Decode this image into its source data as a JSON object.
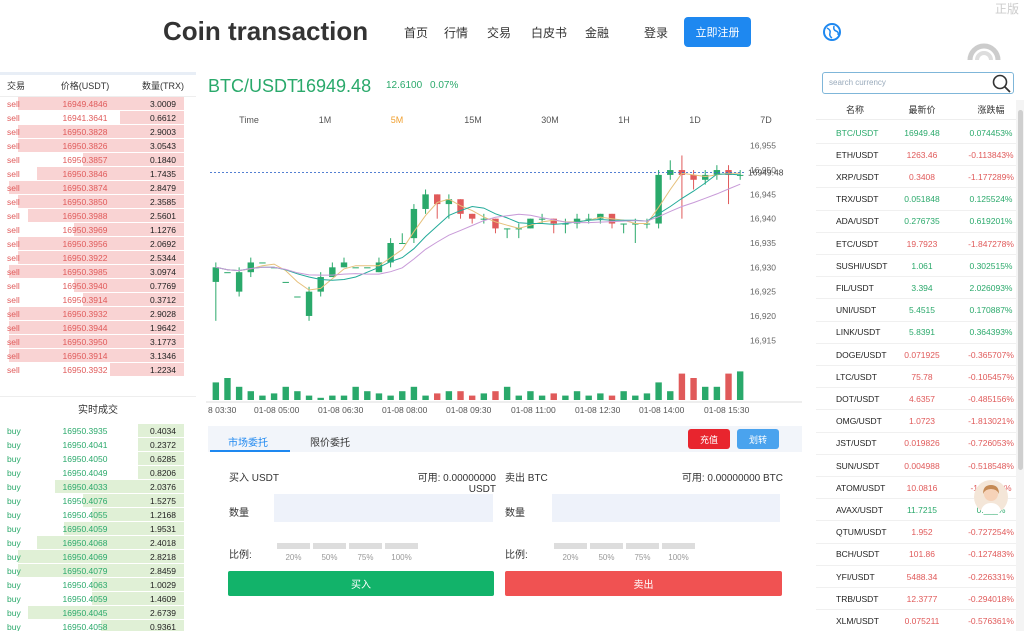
{
  "header": {
    "title": "Coin transaction",
    "nav": [
      "首页",
      "行情",
      "交易",
      "白皮书",
      "金融"
    ],
    "login": "登录",
    "register": "立即注册",
    "watermark": "正版"
  },
  "orderbook": {
    "headers": [
      "交易",
      "价格(USDT)",
      "数量(TRX)"
    ],
    "sells": [
      {
        "side": "sell",
        "price": "16949.4846",
        "qty": "3.0009",
        "depth": 0.9
      },
      {
        "side": "sell",
        "price": "16941.3641",
        "qty": "0.6612",
        "depth": 0.35
      },
      {
        "side": "sell",
        "price": "16950.3828",
        "qty": "2.9003",
        "depth": 0.9
      },
      {
        "side": "sell",
        "price": "16950.3826",
        "qty": "3.0543",
        "depth": 0.9
      },
      {
        "side": "sell",
        "price": "16950.3857",
        "qty": "0.1840",
        "depth": 0.55
      },
      {
        "side": "sell",
        "price": "16950.3846",
        "qty": "1.7435",
        "depth": 0.8
      },
      {
        "side": "sell",
        "price": "16950.3874",
        "qty": "2.8479",
        "depth": 0.95
      },
      {
        "side": "sell",
        "price": "16950.3850",
        "qty": "2.3585",
        "depth": 0.9
      },
      {
        "side": "sell",
        "price": "16950.3988",
        "qty": "2.5601",
        "depth": 0.85
      },
      {
        "side": "sell",
        "price": "16950.3969",
        "qty": "1.1276",
        "depth": 0.6
      },
      {
        "side": "sell",
        "price": "16950.3956",
        "qty": "2.0692",
        "depth": 0.9
      },
      {
        "side": "sell",
        "price": "16950.3922",
        "qty": "2.5344",
        "depth": 0.9
      },
      {
        "side": "sell",
        "price": "16950.3985",
        "qty": "3.0974",
        "depth": 0.95
      },
      {
        "side": "sell",
        "price": "16950.3940",
        "qty": "0.7769",
        "depth": 0.6
      },
      {
        "side": "sell",
        "price": "16950.3914",
        "qty": "0.3712",
        "depth": 0.55
      },
      {
        "side": "sell",
        "price": "16950.3932",
        "qty": "2.9028",
        "depth": 0.95
      },
      {
        "side": "sell",
        "price": "16950.3944",
        "qty": "1.9642",
        "depth": 0.95
      },
      {
        "side": "sell",
        "price": "16950.3950",
        "qty": "3.1773",
        "depth": 0.95
      },
      {
        "side": "sell",
        "price": "16950.3914",
        "qty": "3.1346",
        "depth": 0.95
      },
      {
        "side": "sell",
        "price": "16950.3932",
        "qty": "1.2234",
        "depth": 0.4
      }
    ],
    "trades_title": "实时成交",
    "buys": [
      {
        "side": "buy",
        "price": "16950.3935",
        "qty": "0.4034",
        "depth": 0.25
      },
      {
        "side": "buy",
        "price": "16950.4041",
        "qty": "0.2372",
        "depth": 0.25
      },
      {
        "side": "buy",
        "price": "16950.4050",
        "qty": "0.6285",
        "depth": 0.25
      },
      {
        "side": "buy",
        "price": "16950.4049",
        "qty": "0.8206",
        "depth": 0.25
      },
      {
        "side": "buy",
        "price": "16950.4033",
        "qty": "2.0376",
        "depth": 0.7
      },
      {
        "side": "buy",
        "price": "16950.4076",
        "qty": "1.5275",
        "depth": 0.55
      },
      {
        "side": "buy",
        "price": "16950.4055",
        "qty": "1.2168",
        "depth": 0.5
      },
      {
        "side": "buy",
        "price": "16950.4059",
        "qty": "1.9531",
        "depth": 0.65
      },
      {
        "side": "buy",
        "price": "16950.4068",
        "qty": "2.4018",
        "depth": 0.8
      },
      {
        "side": "buy",
        "price": "16950.4069",
        "qty": "2.8218",
        "depth": 0.9
      },
      {
        "side": "buy",
        "price": "16950.4079",
        "qty": "2.8459",
        "depth": 0.9
      },
      {
        "side": "buy",
        "price": "16950.4063",
        "qty": "1.0029",
        "depth": 0.5
      },
      {
        "side": "buy",
        "price": "16950.4059",
        "qty": "1.4609",
        "depth": 0.5
      },
      {
        "side": "buy",
        "price": "16950.4045",
        "qty": "2.6739",
        "depth": 0.85
      },
      {
        "side": "buy",
        "price": "16950.4058",
        "qty": "0.9361",
        "depth": 0.45
      }
    ]
  },
  "pair": {
    "symbol": "BTC/USDT",
    "price": "16949.48",
    "change": "12.6100",
    "change_pct": "0.07%"
  },
  "timeframes": [
    "Time",
    "1M",
    "5M",
    "15M",
    "30M",
    "1H",
    "1D",
    "7D"
  ],
  "active_timeframe": "5M",
  "chart_data": {
    "type": "candlestick",
    "y_ticks": [
      "16,955",
      "16,950",
      "16,945",
      "16,940",
      "16,935",
      "16,930",
      "16,925",
      "16,920",
      "16,915"
    ],
    "ylim": [
      16913,
      16957
    ],
    "x_ticks": [
      "8 03:30",
      "01-08 05:00",
      "01-08 06:30",
      "01-08 08:00",
      "01-08 09:30",
      "01-08 11:00",
      "01-08 12:30",
      "01-08 14:00",
      "01-08 15:30"
    ],
    "last_price_label": "16949.48",
    "candles": [
      [
        16927,
        16930,
        16919,
        16931
      ],
      [
        16929,
        16929,
        16925,
        16925
      ],
      [
        16925,
        16929,
        16924,
        16930
      ],
      [
        16929,
        16931,
        16928,
        16932
      ],
      [
        16931,
        16931,
        16929,
        16929
      ],
      [
        16930,
        16930,
        16927,
        16927
      ],
      [
        16927,
        16927,
        16924,
        16924
      ],
      [
        16924,
        16924,
        16920,
        16920
      ],
      [
        16920,
        16925,
        16919,
        16926
      ],
      [
        16925,
        16928,
        16924,
        16929
      ],
      [
        16928,
        16930,
        16928,
        16931
      ],
      [
        16930,
        16931,
        16930,
        16932
      ],
      [
        16930,
        16930,
        16930,
        16930
      ],
      [
        16930,
        16930,
        16930,
        16930
      ],
      [
        16929,
        16931,
        16929,
        16932
      ],
      [
        16931,
        16935,
        16930,
        16936
      ],
      [
        16935,
        16935,
        16935,
        16937
      ],
      [
        16936,
        16942,
        16935,
        16943
      ],
      [
        16942,
        16945,
        16941,
        16946
      ],
      [
        16945,
        16943,
        16940,
        16945
      ],
      [
        16943,
        16944,
        16940,
        16945
      ],
      [
        16944,
        16941,
        16940,
        16944
      ],
      [
        16941,
        16940,
        16939,
        16941
      ],
      [
        16940,
        16940,
        16939,
        16941
      ],
      [
        16940,
        16938,
        16937,
        16940
      ],
      [
        16938,
        16938,
        16936,
        16938
      ],
      [
        16938,
        16938,
        16936,
        16939
      ],
      [
        16938,
        16940,
        16938,
        16940
      ],
      [
        16940,
        16940,
        16939,
        16941
      ],
      [
        16940,
        16939,
        16937,
        16940
      ],
      [
        16939,
        16939,
        16937,
        16940
      ],
      [
        16939,
        16940,
        16938,
        16941
      ],
      [
        16940,
        16940,
        16939,
        16941
      ],
      [
        16940,
        16941,
        16939,
        16941
      ],
      [
        16941,
        16939,
        16938,
        16941
      ],
      [
        16939,
        16939,
        16937,
        16939
      ],
      [
        16939,
        16939,
        16935,
        16940
      ],
      [
        16939,
        16939,
        16938,
        16940
      ],
      [
        16939,
        16949,
        16938,
        16950
      ],
      [
        16949,
        16950,
        16948,
        16952
      ],
      [
        16950,
        16949,
        16940,
        16953
      ],
      [
        16949,
        16948,
        16946,
        16950
      ],
      [
        16948,
        16949,
        16947,
        16950
      ],
      [
        16949,
        16950,
        16948,
        16951
      ],
      [
        16950,
        16949,
        16943,
        16951
      ],
      [
        16949,
        16949,
        16948,
        16950
      ]
    ],
    "volumes": [
      0.4,
      0.5,
      0.3,
      0.2,
      0.1,
      0.15,
      0.3,
      0.2,
      0.1,
      0.05,
      0.1,
      0.1,
      0.3,
      0.2,
      0.15,
      0.1,
      0.2,
      0.3,
      0.1,
      0.15,
      0.2,
      0.2,
      0.1,
      0.15,
      0.2,
      0.3,
      0.1,
      0.2,
      0.1,
      0.15,
      0.1,
      0.2,
      0.1,
      0.15,
      0.1,
      0.2,
      0.1,
      0.15,
      0.4,
      0.2,
      0.6,
      0.5,
      0.3,
      0.3,
      0.6,
      0.65
    ]
  },
  "order": {
    "tabs": [
      "市场委托",
      "限价委托"
    ],
    "deposit": "充值",
    "transfer": "划转",
    "buy_title": "买入 USDT",
    "sell_title": "卖出 BTC",
    "available_buy": "可用: 0.00000000 USDT",
    "available_sell": "可用: 0.00000000 BTC",
    "qty_label": "数量",
    "ratio_label": "比例:",
    "percentages": [
      "20%",
      "50%",
      "75%",
      "100%"
    ],
    "buy_button": "买入",
    "sell_button": "卖出"
  },
  "market": {
    "search_placeholder": "search currency",
    "headers": [
      "名称",
      "最新价",
      "涨跌幅"
    ],
    "rows": [
      {
        "name": "BTC/USDT",
        "price": "16949.48",
        "change": "0.074453%",
        "dir": "up"
      },
      {
        "name": "ETH/USDT",
        "price": "1263.46",
        "change": "-0.113843%",
        "dir": "down"
      },
      {
        "name": "XRP/USDT",
        "price": "0.3408",
        "change": "-1.177289%",
        "dir": "down"
      },
      {
        "name": "TRX/USDT",
        "price": "0.051848",
        "change": "0.125524%",
        "dir": "up"
      },
      {
        "name": "ADA/USDT",
        "price": "0.276735",
        "change": "0.619201%",
        "dir": "up"
      },
      {
        "name": "ETC/USDT",
        "price": "19.7923",
        "change": "-1.847278%",
        "dir": "down"
      },
      {
        "name": "SUSHI/USDT",
        "price": "1.061",
        "change": "0.302515%",
        "dir": "up"
      },
      {
        "name": "FIL/USDT",
        "price": "3.394",
        "change": "2.026093%",
        "dir": "up"
      },
      {
        "name": "UNI/USDT",
        "price": "5.4515",
        "change": "0.170887%",
        "dir": "up"
      },
      {
        "name": "LINK/USDT",
        "price": "5.8391",
        "change": "0.364393%",
        "dir": "up"
      },
      {
        "name": "DOGE/USDT",
        "price": "0.071925",
        "change": "-0.365707%",
        "dir": "down"
      },
      {
        "name": "LTC/USDT",
        "price": "75.78",
        "change": "-0.105457%",
        "dir": "down"
      },
      {
        "name": "DOT/USDT",
        "price": "4.6357",
        "change": "-0.485156%",
        "dir": "down"
      },
      {
        "name": "OMG/USDT",
        "price": "1.0723",
        "change": "-1.813021%",
        "dir": "down"
      },
      {
        "name": "JST/USDT",
        "price": "0.019826",
        "change": "-0.726053%",
        "dir": "down"
      },
      {
        "name": "SUN/USDT",
        "price": "0.004988",
        "change": "-0.518548%",
        "dir": "down"
      },
      {
        "name": "ATOM/USDT",
        "price": "10.0816",
        "change": "-1.___16%",
        "dir": "down"
      },
      {
        "name": "AVAX/USDT",
        "price": "11.7215",
        "change": "0.___%",
        "dir": "up"
      },
      {
        "name": "QTUM/USDT",
        "price": "1.952",
        "change": "-0.727254%",
        "dir": "down"
      },
      {
        "name": "BCH/USDT",
        "price": "101.86",
        "change": "-0.127483%",
        "dir": "down"
      },
      {
        "name": "YFI/USDT",
        "price": "5488.34",
        "change": "-0.226331%",
        "dir": "down"
      },
      {
        "name": "TRB/USDT",
        "price": "12.3777",
        "change": "-0.294018%",
        "dir": "down"
      },
      {
        "name": "XLM/USDT",
        "price": "0.075211",
        "change": "-0.576361%",
        "dir": "down"
      }
    ]
  },
  "colors": {
    "up": "#2aa96b",
    "down": "#e05a5a",
    "accent": "#1e88f0",
    "buy_button": "#12b36a",
    "sell_button": "#f05252",
    "deposit": "#e8252e",
    "transfer": "#4aa3ee"
  }
}
